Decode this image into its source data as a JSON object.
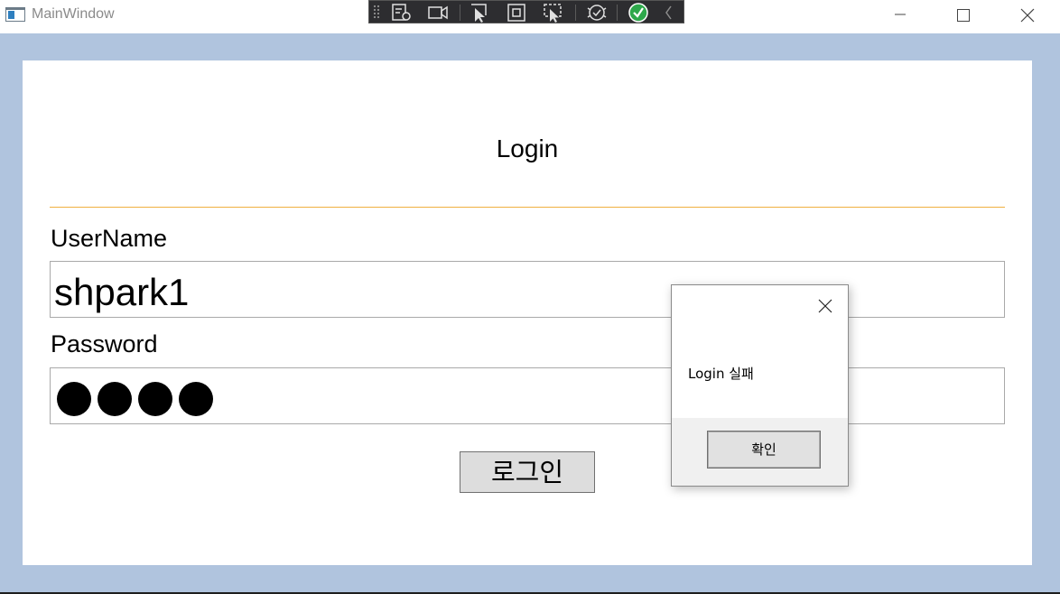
{
  "window": {
    "title": "MainWindow",
    "controls": [
      "minimize-icon",
      "maximize-icon",
      "close-icon"
    ]
  },
  "debug_toolbar": {
    "items": [
      "live-visual-tree-icon",
      "record-icon",
      "select-element-icon",
      "display-layout-adorners-icon",
      "track-focus-icon",
      "hot-reload-icon",
      "check-icon",
      "chevron-left-icon"
    ]
  },
  "login": {
    "title": "Login",
    "username_label": "UserName",
    "username_value": "shpark1",
    "password_label": "Password",
    "password_mask_count": 4,
    "login_button": "로그인"
  },
  "message_box": {
    "message": "Login 실패",
    "ok_button": "확인"
  },
  "colors": {
    "client_background": "#b0c4de",
    "divider": "#f0b040",
    "button_face": "#dddddd"
  }
}
